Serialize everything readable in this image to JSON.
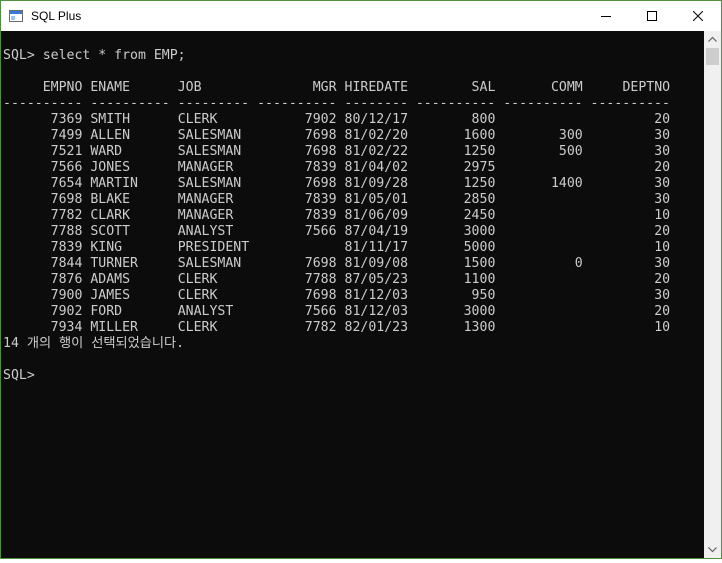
{
  "window": {
    "title": "SQL Plus",
    "icon": "sqlplus-app-icon",
    "controls": [
      "minimize-icon",
      "maximize-icon",
      "close-icon"
    ]
  },
  "console": {
    "prompt": "SQL> ",
    "command": "select * from EMP;",
    "columns": [
      "EMPNO",
      "ENAME",
      "JOB",
      "MGR",
      "HIREDATE",
      "SAL",
      "COMM",
      "DEPTNO"
    ],
    "rows": [
      [
        "7369",
        "SMITH",
        "CLERK",
        "7902",
        "80/12/17",
        "800",
        "",
        "20"
      ],
      [
        "7499",
        "ALLEN",
        "SALESMAN",
        "7698",
        "81/02/20",
        "1600",
        "300",
        "30"
      ],
      [
        "7521",
        "WARD",
        "SALESMAN",
        "7698",
        "81/02/22",
        "1250",
        "500",
        "30"
      ],
      [
        "7566",
        "JONES",
        "MANAGER",
        "7839",
        "81/04/02",
        "2975",
        "",
        "20"
      ],
      [
        "7654",
        "MARTIN",
        "SALESMAN",
        "7698",
        "81/09/28",
        "1250",
        "1400",
        "30"
      ],
      [
        "7698",
        "BLAKE",
        "MANAGER",
        "7839",
        "81/05/01",
        "2850",
        "",
        "30"
      ],
      [
        "7782",
        "CLARK",
        "MANAGER",
        "7839",
        "81/06/09",
        "2450",
        "",
        "10"
      ],
      [
        "7788",
        "SCOTT",
        "ANALYST",
        "7566",
        "87/04/19",
        "3000",
        "",
        "20"
      ],
      [
        "7839",
        "KING",
        "PRESIDENT",
        "",
        "81/11/17",
        "5000",
        "",
        "10"
      ],
      [
        "7844",
        "TURNER",
        "SALESMAN",
        "7698",
        "81/09/08",
        "1500",
        "0",
        "30"
      ],
      [
        "7876",
        "ADAMS",
        "CLERK",
        "7788",
        "87/05/23",
        "1100",
        "",
        "20"
      ],
      [
        "7900",
        "JAMES",
        "CLERK",
        "7698",
        "81/12/03",
        "950",
        "",
        "30"
      ],
      [
        "7902",
        "FORD",
        "ANALYST",
        "7566",
        "81/12/03",
        "3000",
        "",
        "20"
      ],
      [
        "7934",
        "MILLER",
        "CLERK",
        "7782",
        "82/01/23",
        "1300",
        "",
        "10"
      ]
    ],
    "result_message": "14 개의 행이 선택되었습니다.",
    "final_prompt": "SQL>"
  }
}
